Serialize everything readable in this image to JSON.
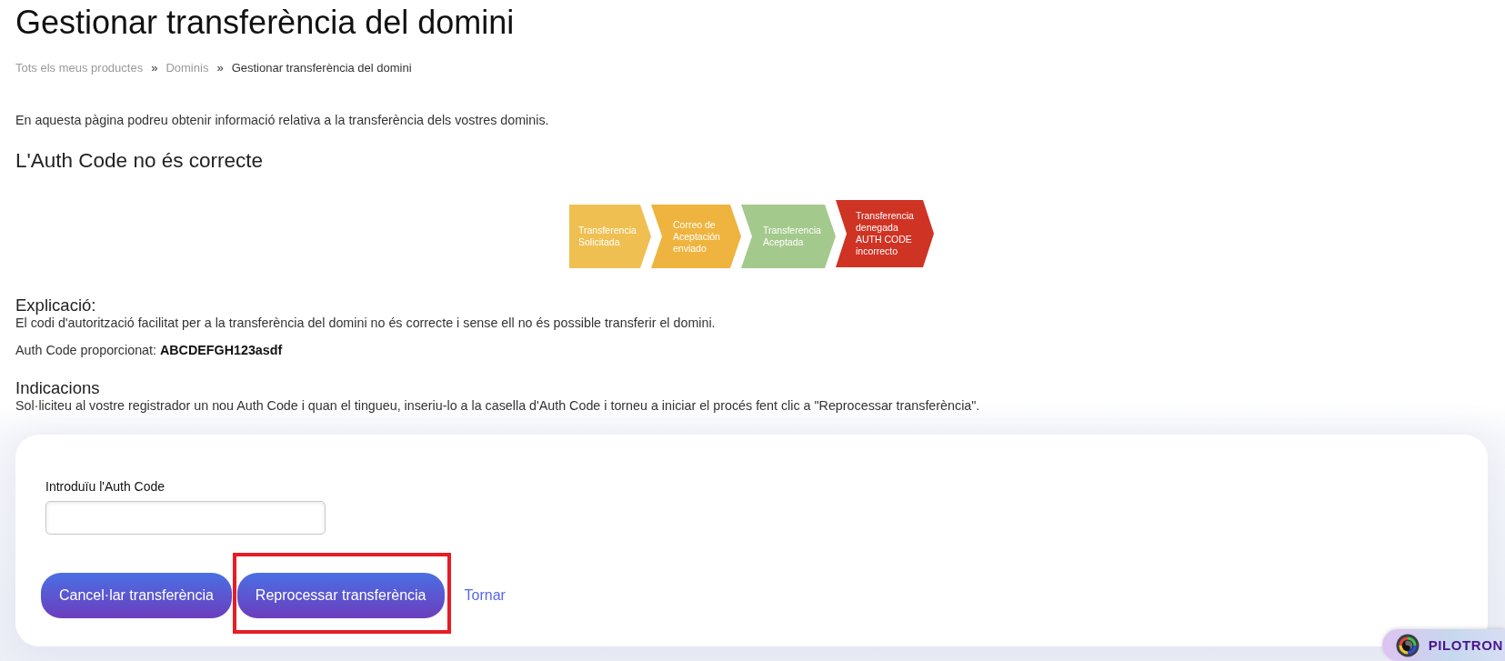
{
  "page": {
    "title": "Gestionar transferència del domini"
  },
  "breadcrumb": [
    {
      "label": "Tots els meus productes",
      "current": false
    },
    {
      "separator": "»",
      "label": "Dominis",
      "current": false
    },
    {
      "separator": "»",
      "label": "Gestionar transferència del domini",
      "current": true
    }
  ],
  "intro": "En aquesta pàgina podreu obtenir informació relativa a la transferència dels vostres dominis.",
  "status_heading": "L'Auth Code no és correcte",
  "steps": [
    {
      "label": "Transferencia Solicitada",
      "color": "#efbf52",
      "current": false
    },
    {
      "label": "Correo de Aceptación enviado",
      "color": "#eeb43f",
      "current": false
    },
    {
      "label": "Transferencia Aceptada",
      "color": "#a4c98c",
      "current": false
    },
    {
      "label": "Transferencia denegada AUTH CODE incorrecto",
      "color": "#cf3324",
      "current": true
    }
  ],
  "explanation": {
    "heading": "Explicació:",
    "text": "El codi d'autorització facilitat per a la transferència del domini no és correcte i sense ell no és possible transferir el domini.",
    "auth_code": "Auth Code proporcionat: **ABCDEFGH123asdf**"
  },
  "instructions": {
    "heading": "Indicacions",
    "text": "Sol·liciteu al vostre registrador un nou Auth Code i quan el tingueu, inseriu-lo a la casella d'Auth Code i torneu a iniciar el procés fent clic a \"Reprocessar transferència\"."
  },
  "form": {
    "field_label": "Introduïu l'Auth Code",
    "actions": [
      {
        "kind": "button",
        "label": "Cancel·lar transferència",
        "highlighted": false
      },
      {
        "kind": "button",
        "label": "Reprocessar transferència",
        "highlighted": true
      },
      {
        "kind": "link",
        "label": "Tornar",
        "highlighted": false
      }
    ]
  },
  "floating_button": {
    "label": "PILOTRON"
  }
}
